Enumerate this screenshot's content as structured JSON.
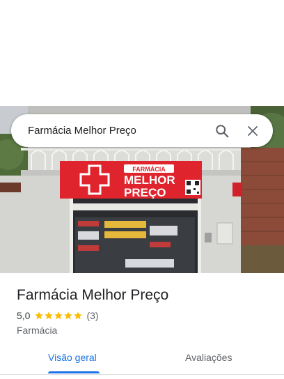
{
  "search": {
    "query": "Farmácia Melhor Preço",
    "search_icon": "search-icon",
    "close_icon": "close-icon"
  },
  "photo": {
    "sign_top": "FARMÁCIA",
    "sign_line1": "MELHOR",
    "sign_line2": "PREÇO",
    "colors": {
      "sign_red": "#e0242d",
      "wall": "#d9d9d6",
      "sky": "#c9ccd0"
    }
  },
  "place": {
    "title": "Farmácia Melhor Preço",
    "rating": "5,0",
    "stars": 5,
    "review_count": "(3)",
    "category": "Farmácia",
    "star_color": "#fbbc04"
  },
  "tabs": [
    {
      "label": "Visão geral",
      "active": true
    },
    {
      "label": "Avaliações",
      "active": false
    }
  ],
  "colors": {
    "accent": "#1a73e8"
  }
}
